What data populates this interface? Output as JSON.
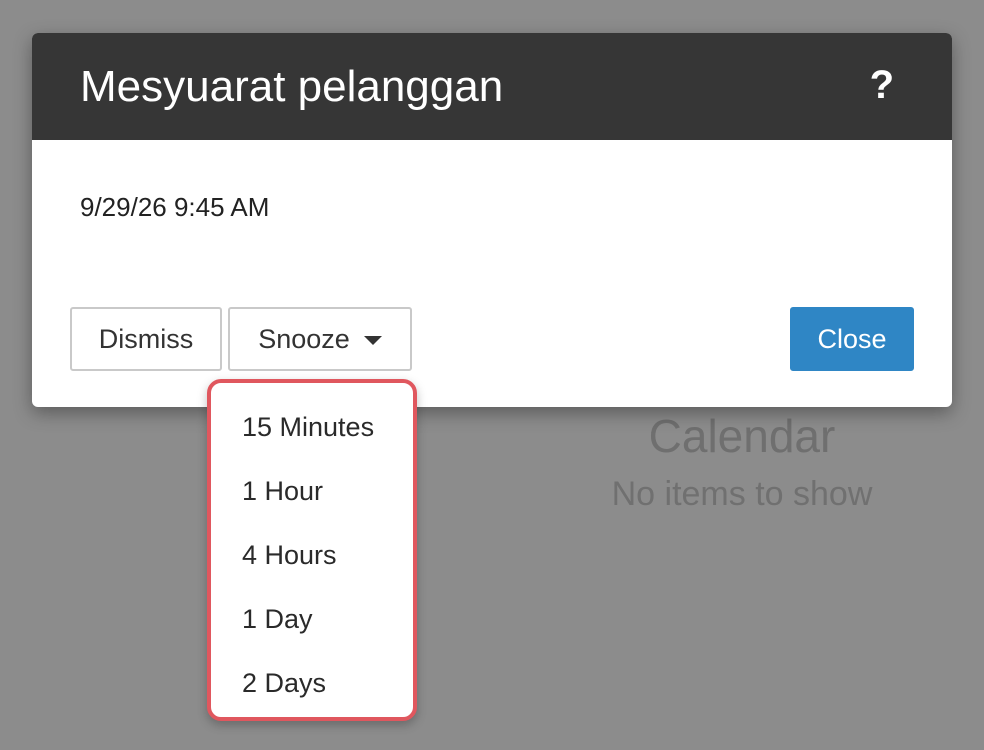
{
  "background": {
    "calendar_title": "Calendar",
    "calendar_empty": "No items to show"
  },
  "dialog": {
    "title": "Mesyuarat pelanggan",
    "help_label": "?",
    "datetime": "9/29/26 9:45 AM",
    "dismiss_label": "Dismiss",
    "snooze_label": "Snooze",
    "close_label": "Close"
  },
  "snooze_menu": {
    "items": [
      {
        "label": "15 Minutes"
      },
      {
        "label": "1 Hour"
      },
      {
        "label": "4 Hours"
      },
      {
        "label": "1 Day"
      },
      {
        "label": "2 Days"
      }
    ]
  },
  "colors": {
    "overlay": "#8c8c8c",
    "header": "#363636",
    "accent": "#2f86c5",
    "menu_highlight_border": "#e0575e"
  },
  "icons": {
    "snooze_caret": "caret-down-icon"
  }
}
